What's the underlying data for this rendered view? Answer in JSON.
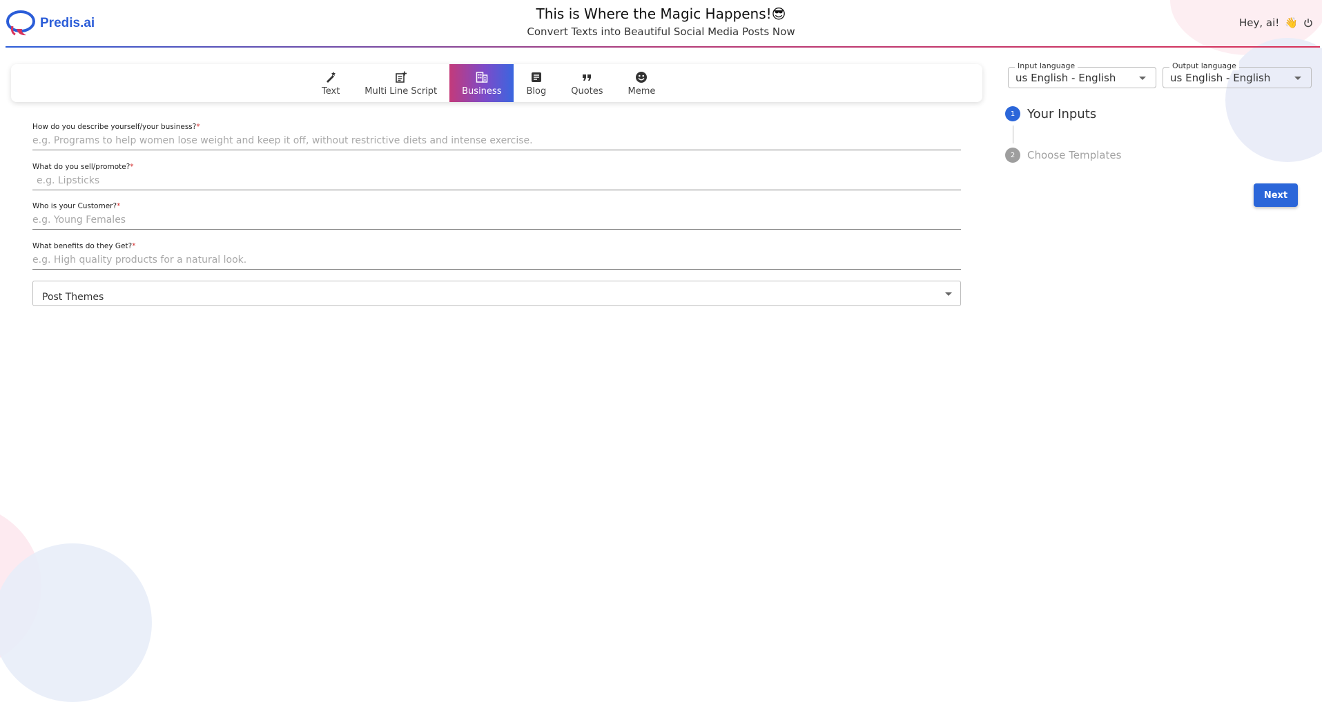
{
  "header": {
    "brand": "Predis.ai",
    "title": "This is Where the Magic Happens!",
    "title_emoji": "😎",
    "subtitle": "Convert Texts into Beautiful Social Media Posts Now",
    "greeting": "Hey, ai!",
    "greeting_emoji": "👋"
  },
  "tabs": [
    {
      "label": "Text",
      "icon": "magic-wand-icon"
    },
    {
      "label": "Multi Line Script",
      "icon": "post-add-icon"
    },
    {
      "label": "Business",
      "icon": "business-icon",
      "active": true
    },
    {
      "label": "Blog",
      "icon": "article-icon"
    },
    {
      "label": "Quotes",
      "icon": "quote-icon"
    },
    {
      "label": "Meme",
      "icon": "smiley-icon"
    }
  ],
  "form": {
    "fields": [
      {
        "label": "How do you describe yourself/your business?",
        "required_mark": "*",
        "placeholder": "e.g. Programs to help women lose weight and keep it off, without restrictive diets and intense exercise.",
        "value": ""
      },
      {
        "label": "What do you sell/promote?",
        "required_mark": "*",
        "placeholder": "e.g. Lipsticks",
        "value": ""
      },
      {
        "label": "Who is your Customer?",
        "required_mark": "*",
        "placeholder": "e.g. Young Females",
        "value": ""
      },
      {
        "label": "What benefits do they Get?",
        "required_mark": "*",
        "placeholder": "e.g. High quality products for a natural look.",
        "value": ""
      }
    ],
    "post_themes_label": "Post Themes"
  },
  "languages": {
    "input": {
      "legend": "Input language",
      "value": "us English - English"
    },
    "output": {
      "legend": "Output language",
      "value": "us English - English"
    }
  },
  "steps": [
    {
      "num": "1",
      "label": "Your Inputs",
      "state": "active"
    },
    {
      "num": "2",
      "label": "Choose Templates",
      "state": "inactive"
    }
  ],
  "next_label": "Next",
  "colors": {
    "primary": "#2b66d9",
    "gradient_start": "#c33a7a",
    "gradient_end": "#3a66df",
    "required": "#d32f2f"
  }
}
